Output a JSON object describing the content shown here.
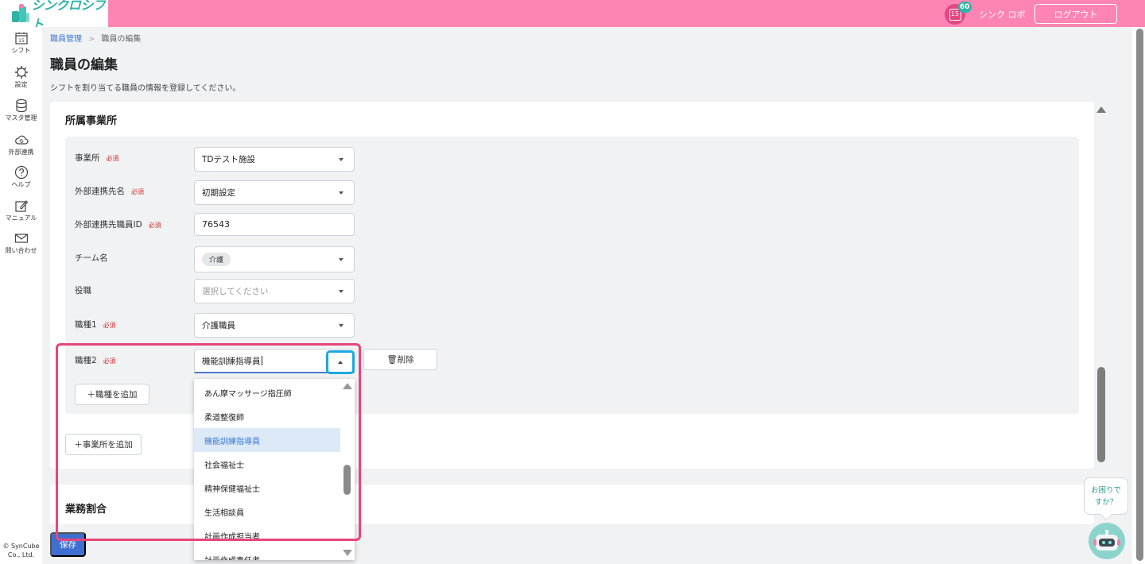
{
  "brand": {
    "name": "シンクロシフト",
    "accent": "#fd84b3",
    "logo_color": "#2fb2a8"
  },
  "header": {
    "notification_count": "60",
    "calendar_day": "15",
    "user_name": "シンク ロボ",
    "logout_label": "ログアウト"
  },
  "sidebar": {
    "items": [
      {
        "label": "シフト",
        "icon": "calendar-icon"
      },
      {
        "label": "設定",
        "icon": "gear-icon"
      },
      {
        "label": "マスタ管理",
        "icon": "database-icon"
      },
      {
        "label": "外部連携",
        "icon": "cloud-sync-icon"
      },
      {
        "label": "ヘルプ",
        "icon": "help-icon"
      },
      {
        "label": "マニュアル",
        "icon": "edit-icon"
      },
      {
        "label": "問い合わせ",
        "icon": "mail-icon"
      }
    ],
    "calendar_day": "15",
    "copyright": "© SynCube Co., Ltd."
  },
  "breadcrumb": {
    "parent": "職員管理",
    "separator": ">",
    "current": "職員の編集"
  },
  "page": {
    "title": "職員の編集",
    "description": "シフトを割り当てる職員の情報を登録してください。"
  },
  "form": {
    "section_title": "所属事業所",
    "required_label": "必須",
    "office": {
      "label": "事業所",
      "value": "TDテスト施設"
    },
    "external_partner": {
      "label": "外部連携先名",
      "value": "初期設定"
    },
    "external_staff_id": {
      "label": "外部連携先職員ID",
      "value": "76543"
    },
    "team": {
      "label": "チーム名",
      "chip": "介護"
    },
    "position": {
      "label": "役職",
      "placeholder": "選択してください"
    },
    "job_type1": {
      "label": "職種1",
      "value": "介護職員"
    },
    "job_type2": {
      "label": "職種2",
      "value": "機能訓練指導員"
    },
    "delete_label": "🗑削除",
    "add_job_type_label": "＋職種を追加",
    "add_office_label": "＋事業所を追加"
  },
  "dropdown": {
    "options": [
      "あん摩マッサージ指圧師",
      "柔道整復師",
      "機能訓練指導員",
      "社会福祉士",
      "精神保健福祉士",
      "生活相談員",
      "計画作成担当者",
      "計画作成責任者"
    ],
    "selected": "機能訓練指導員"
  },
  "section2": {
    "title": "業務割合"
  },
  "save_label": "保存",
  "help": {
    "line1": "お困りで",
    "line2": "すか？"
  }
}
